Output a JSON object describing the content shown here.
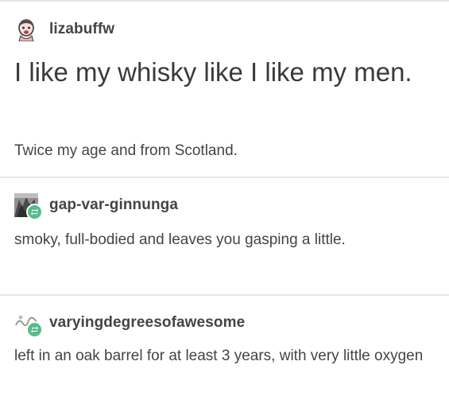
{
  "posts": [
    {
      "username": "lizabuffw",
      "avatar_icon": "cartoon-avatar-icon",
      "headline": "I like my whisky like I like my men.",
      "text": "Twice my age and from Scotland."
    },
    {
      "username": "gap-var-ginnunga",
      "avatar_icon": "photo-avatar-icon",
      "reblog_icon": "reblog-icon",
      "text": "smoky, full-bodied and leaves you gasping a little."
    },
    {
      "username": "varyingdegreesofawesome",
      "avatar_icon": "logo-avatar-icon",
      "reblog_icon": "reblog-icon",
      "text": "left in an oak barrel for at least 3 years, with very little oxygen"
    }
  ],
  "colors": {
    "reblog_badge": "#56bc8a",
    "divider": "#e6e6e6",
    "text": "#444444"
  }
}
